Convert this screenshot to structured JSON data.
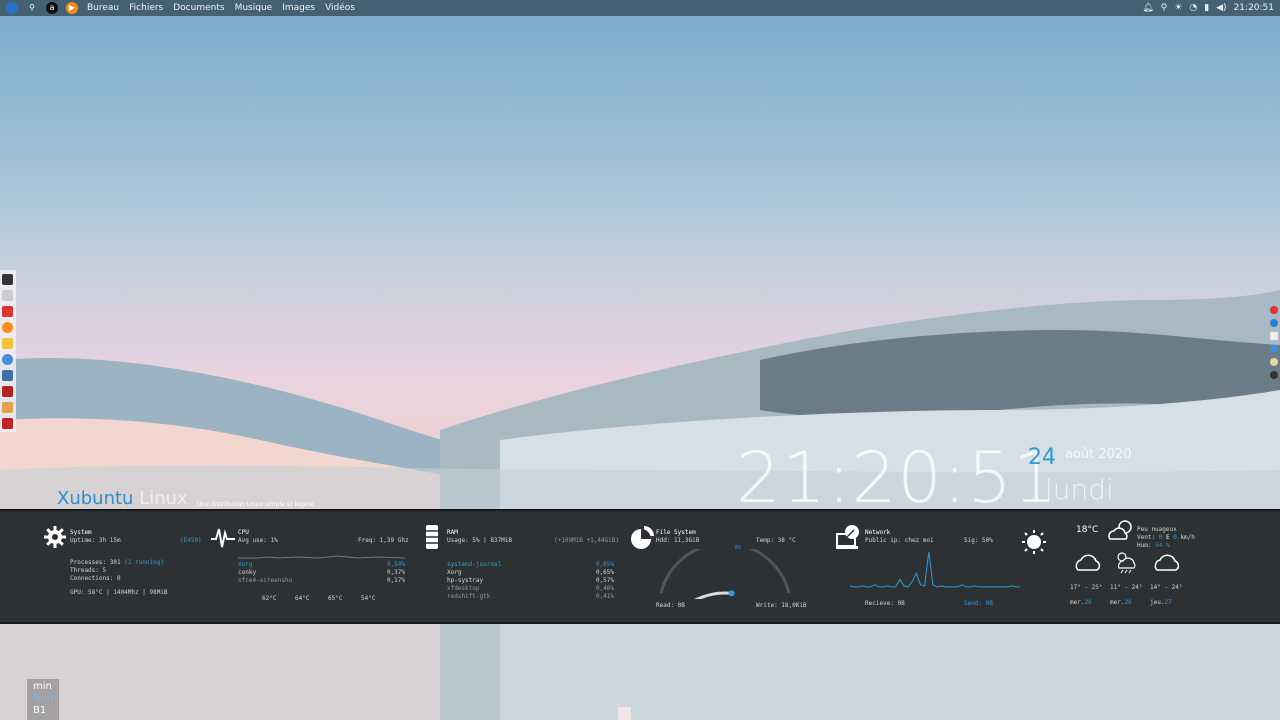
{
  "top_panel": {
    "menu": [
      "Bureau",
      "Fichiers",
      "Documents",
      "Musique",
      "Images",
      "Vidéos"
    ],
    "time": "21:20:51"
  },
  "desktop": {
    "clock": "21:20:51",
    "day": "24",
    "month": "août 2020",
    "weekday": "lundi",
    "brand_main": "Xubuntu",
    "brand_dim": "Linux",
    "tagline": "Une distribution Linux simple et légère."
  },
  "conky": {
    "system": {
      "title": "System",
      "uptime": "Uptime: 3h 15m",
      "host": "(E450)",
      "processes_label": "Processes: 301",
      "processes_running": "(1 running)",
      "threads": "Threads: 5",
      "connections": "Connections: 0",
      "gpu": "GPU: 58°C | 1404Mhz | 98MiB"
    },
    "cpu": {
      "title": "CPU",
      "avg": "Avg use: 1%",
      "freq": "Freq: 1,39 Ghz",
      "procs": [
        {
          "name": "Xorg",
          "val": "0,54%"
        },
        {
          "name": "conky",
          "val": "0,37%"
        },
        {
          "name": "xfce4-screensho",
          "val": "0,17%"
        }
      ],
      "core_temps": [
        "62°C",
        "64°C",
        "65°C",
        "54°C"
      ]
    },
    "ram": {
      "title": "RAM",
      "usage": "Usage: 5% | 837MiB",
      "swap": "(+109MiB +1,44GiB)",
      "procs": [
        {
          "name": "systemd-journal",
          "val": "0,05%"
        },
        {
          "name": "Xorg",
          "val": "0,65%"
        },
        {
          "name": "hp-systray",
          "val": "0,57%"
        },
        {
          "name": "xfdesktop",
          "val": "0,46%"
        },
        {
          "name": "redshift-gtk",
          "val": "0,41%"
        }
      ]
    },
    "filesystem": {
      "title": "File System",
      "hdd": "Hdd: 11,3GiB",
      "temp": "Temp: 38 °C",
      "read": "Read: 0B",
      "write": "Write: 18,0KiB",
      "gauge_label": "8%",
      "usage_fraction": 0.55
    },
    "network": {
      "title": "Network",
      "public_ip": "Public ip: chez moi",
      "signal": "Sig: 50%",
      "receive": "Recieve: 0B",
      "send": "Send: 0B",
      "graph_values": [
        2,
        1,
        1,
        2,
        1,
        1,
        3,
        1,
        1,
        2,
        1,
        1,
        8,
        2,
        1,
        6,
        14,
        3,
        2,
        34,
        3,
        1,
        2,
        1,
        1,
        1,
        1,
        3,
        1,
        1,
        2,
        1,
        1,
        1,
        1,
        1,
        1,
        1,
        1,
        2,
        1,
        1
      ]
    },
    "weather": {
      "temp": "18°C",
      "condition": "Peu nuageux",
      "wind_label": "Vent:",
      "wind_val": "0",
      "wind_dir": "E",
      "wind_unit": "km/h",
      "humidity_label": "Hum:",
      "humidity_val": "54 %",
      "forecast": [
        {
          "range": "17° - 25°",
          "day": "mer.",
          "num": "26"
        },
        {
          "range": "11° - 24°",
          "day": "mer.",
          "num": "26"
        },
        {
          "range": "14° - 24°",
          "day": "jeu.",
          "num": "27"
        }
      ]
    }
  },
  "bottom_left": {
    "line1": "min",
    "line2": "Num",
    "line3": "B1"
  }
}
